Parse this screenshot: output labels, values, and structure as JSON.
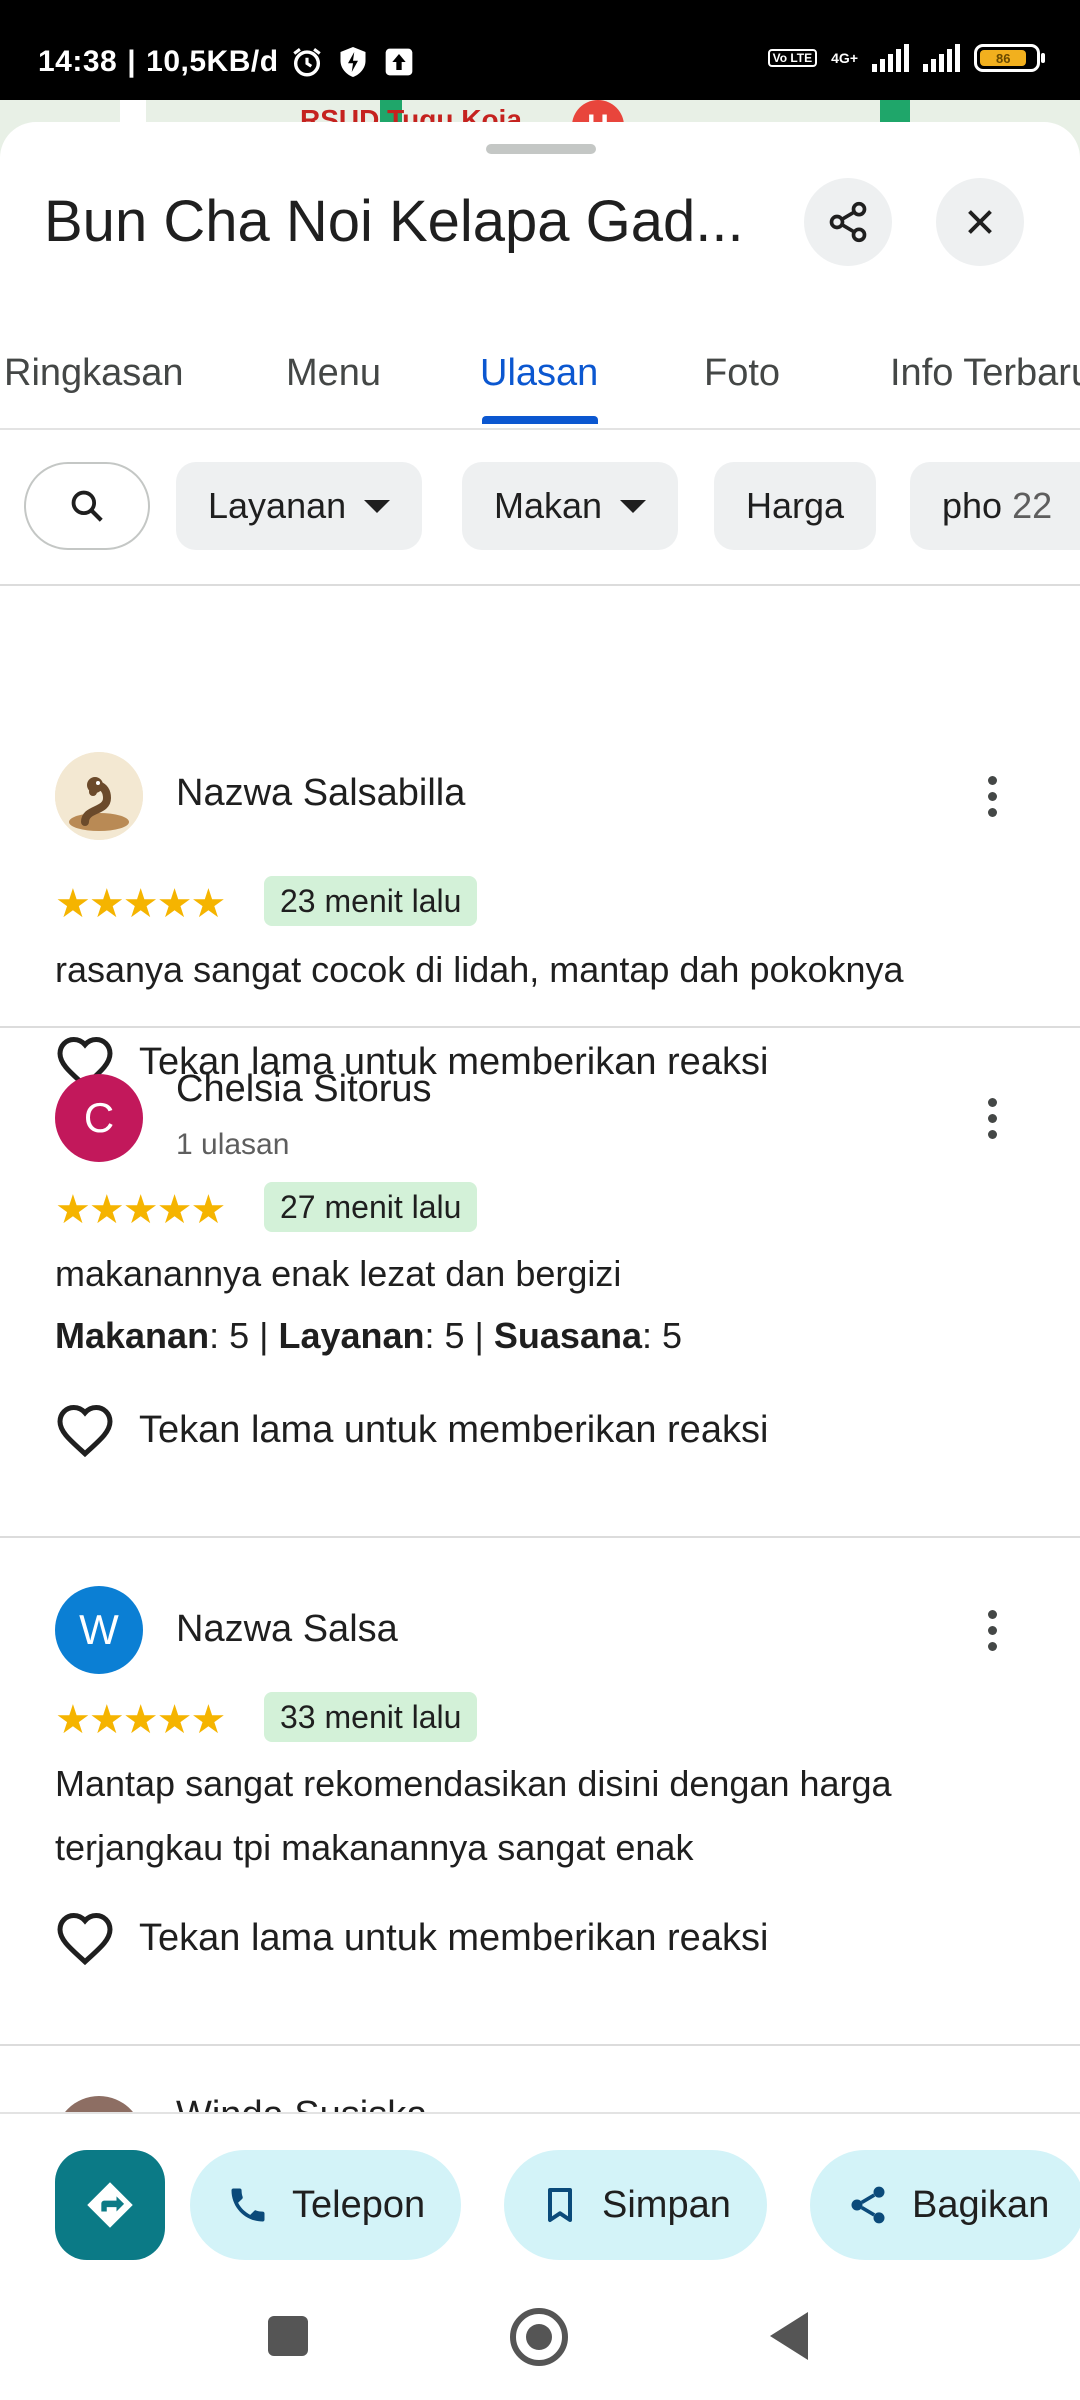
{
  "status_bar": {
    "time": "14:38",
    "separator": "|",
    "speed": "10,5KB/d",
    "network": "4G+",
    "volte": "Vo LTE",
    "battery": "86"
  },
  "map": {
    "label": "RSUD Tugu Koja",
    "hospital_marker": "H"
  },
  "header": {
    "title": "Bun Cha Noi Kelapa Gad..."
  },
  "tabs": [
    {
      "label": "Ringkasan"
    },
    {
      "label": "Menu"
    },
    {
      "label": "Ulasan",
      "active": true
    },
    {
      "label": "Foto"
    },
    {
      "label": "Info Terbaru"
    }
  ],
  "filters": [
    {
      "label": "Layanan",
      "dropdown": true
    },
    {
      "label": "Makan",
      "dropdown": true
    },
    {
      "label": "Harga"
    },
    {
      "label": "pho",
      "count": "22"
    }
  ],
  "reviews": [
    {
      "name": "Nazwa Salsabilla",
      "avatar_letter": "",
      "sub": "",
      "stars": "★★★★★",
      "rating": 5,
      "time": "23 menit lalu",
      "text": "rasanya sangat cocok di lidah, mantap dah pokoknya",
      "react": "Tekan lama untuk memberikan reaksi"
    },
    {
      "name": "Chelsia Sitorus",
      "avatar_letter": "C",
      "sub": "1 ulasan",
      "stars": "★★★★★",
      "rating": 5,
      "time": "27 menit lalu",
      "text": "makanannya enak lezat dan bergizi",
      "aspects": {
        "food_label": "Makanan",
        "food_value": ": 5 | ",
        "service_label": "Layanan",
        "service_value": ": 5 | ",
        "atmosphere_label": "Suasana",
        "atmosphere_value": ": 5"
      },
      "react": "Tekan lama untuk memberikan reaksi"
    },
    {
      "name": "Nazwa Salsa",
      "avatar_letter": "W",
      "sub": "",
      "stars": "★★★★★",
      "rating": 5,
      "time": "33 menit lalu",
      "text": "Mantap sangat rekomendasikan disini dengan harga terjangkau tpi makanannya sangat enak",
      "react": "Tekan lama untuk memberikan reaksi"
    },
    {
      "name": "Winda Susiska"
    }
  ],
  "actions": {
    "call": "Telepon",
    "save": "Simpan",
    "share": "Bagikan"
  },
  "colors": {
    "accent": "#0b57d0",
    "star": "#f5b400",
    "age_badge": "#d3f1d8",
    "action_chip": "#d3f3f8",
    "directions": "#0b7a86",
    "avatar_c": "#c2185b",
    "avatar_w": "#0b7fd4"
  }
}
